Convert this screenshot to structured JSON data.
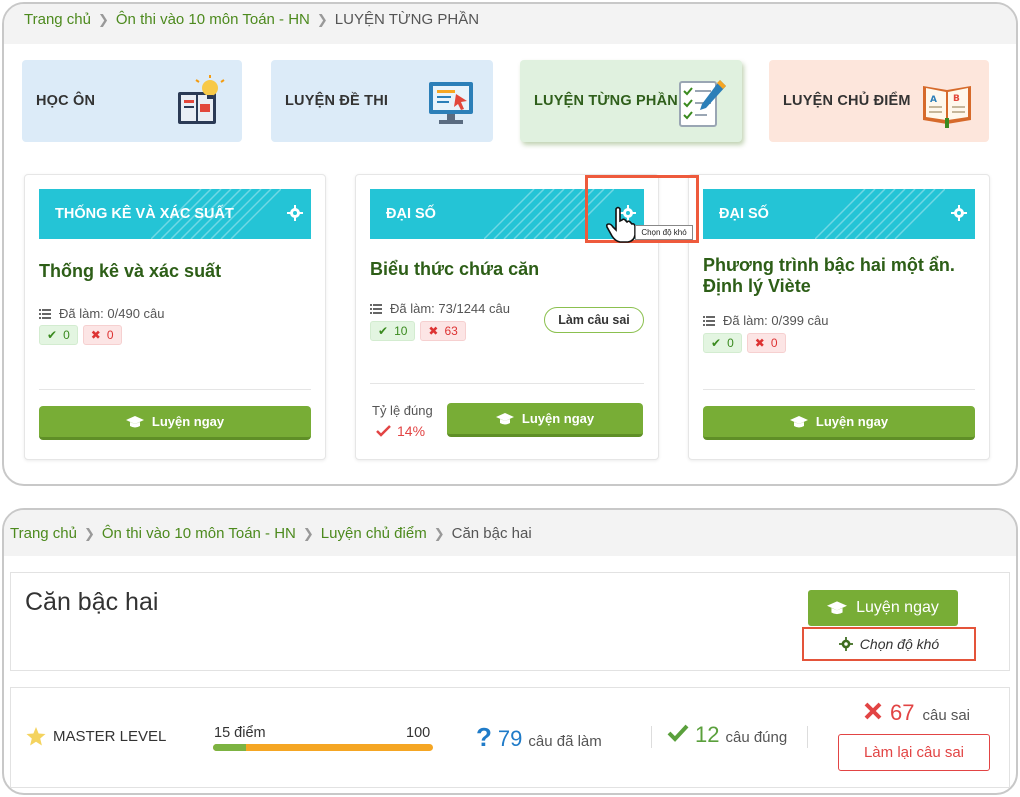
{
  "top": {
    "breadcrumb": [
      "Trang chủ",
      "Ôn thi vào 10 môn Toán - HN",
      "LUYỆN TỪNG PHẦN"
    ],
    "tiles": [
      {
        "label": "HỌC ÔN"
      },
      {
        "label": "LUYỆN ĐỀ THI"
      },
      {
        "label": "LUYỆN TỪNG PHẦN"
      },
      {
        "label": "LUYỆN CHỦ ĐIỂM"
      }
    ],
    "cards": [
      {
        "category": "THỐNG KÊ VÀ XÁC SUẤT",
        "title": "Thống kê và xác suất",
        "done": "Đã làm: 0/490 câu",
        "correct": "0",
        "wrong": "0",
        "action": "Luyện ngay"
      },
      {
        "category": "ĐẠI SỐ",
        "title": "Biểu thức chứa căn",
        "done": "Đã làm: 73/1244 câu",
        "correct": "10",
        "wrong": "63",
        "retry": "Làm câu sai",
        "rate_label": "Tỷ lệ đúng",
        "rate_value": "14%",
        "action": "Luyện ngay"
      },
      {
        "category": "ĐẠI SỐ",
        "title_line1": "Phương trình bậc hai một ẩn.",
        "title_line2": "Định lý Viète",
        "done": "Đã làm: 0/399 câu",
        "correct": "0",
        "wrong": "0",
        "action": "Luyện ngay"
      }
    ],
    "tooltip": "Chọn độ khó",
    "colors": {
      "accent_green": "#78ad36",
      "header_cyan": "#24c4d6",
      "highlight": "#ee5a3c"
    }
  },
  "bottom": {
    "breadcrumb": [
      "Trang chủ",
      "Ôn thi vào 10 môn Toán - HN",
      "Luyện chủ điểm",
      "Căn bậc hai"
    ],
    "title": "Căn bậc hai",
    "start_button": "Luyện ngay",
    "difficulty_button": "Chọn độ khó",
    "level": "MASTER LEVEL",
    "points_label": "15 điểm",
    "points_max": "100",
    "progress_fraction": 0.15,
    "questions_done": "79",
    "questions_done_label": "câu đã làm",
    "correct_count": "12",
    "correct_label": "câu đúng",
    "wrong_count": "67",
    "wrong_label": "câu sai",
    "retry_button": "Làm lại câu sai"
  }
}
